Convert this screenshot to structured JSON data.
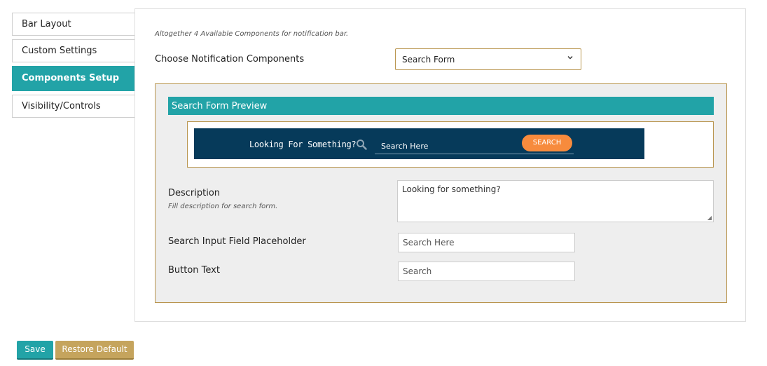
{
  "tabs": [
    {
      "label": "Bar Layout",
      "active": false
    },
    {
      "label": "Custom Settings",
      "active": false
    },
    {
      "label": "Components Setup",
      "active": true
    },
    {
      "label": "Visibility/Controls",
      "active": false
    }
  ],
  "panel": {
    "info_text": "Altogether 4 Available Components for notification bar.",
    "choose_label": "Choose Notification Components",
    "selected_component": "Search Form"
  },
  "preview": {
    "header": "Search Form Preview",
    "bar_text": "Looking For Something?",
    "input_placeholder": "Search Here",
    "button_text": "SEARCH",
    "bar_color": "#063a5a",
    "button_color": "#f78b3d"
  },
  "fields": {
    "description_label": "Description",
    "description_hint": "Fill description for search form.",
    "description_value": "Looking for something?",
    "placeholder_label": "Search Input Field Placeholder",
    "placeholder_value": "Search Here",
    "button_text_label": "Button Text",
    "button_text_value": "Search"
  },
  "actions": {
    "save_label": "Save",
    "restore_label": "Restore Default"
  },
  "colors": {
    "accent": "#22a3a7",
    "border_gold": "#b9954e",
    "restore_button": "#c5a45d"
  }
}
